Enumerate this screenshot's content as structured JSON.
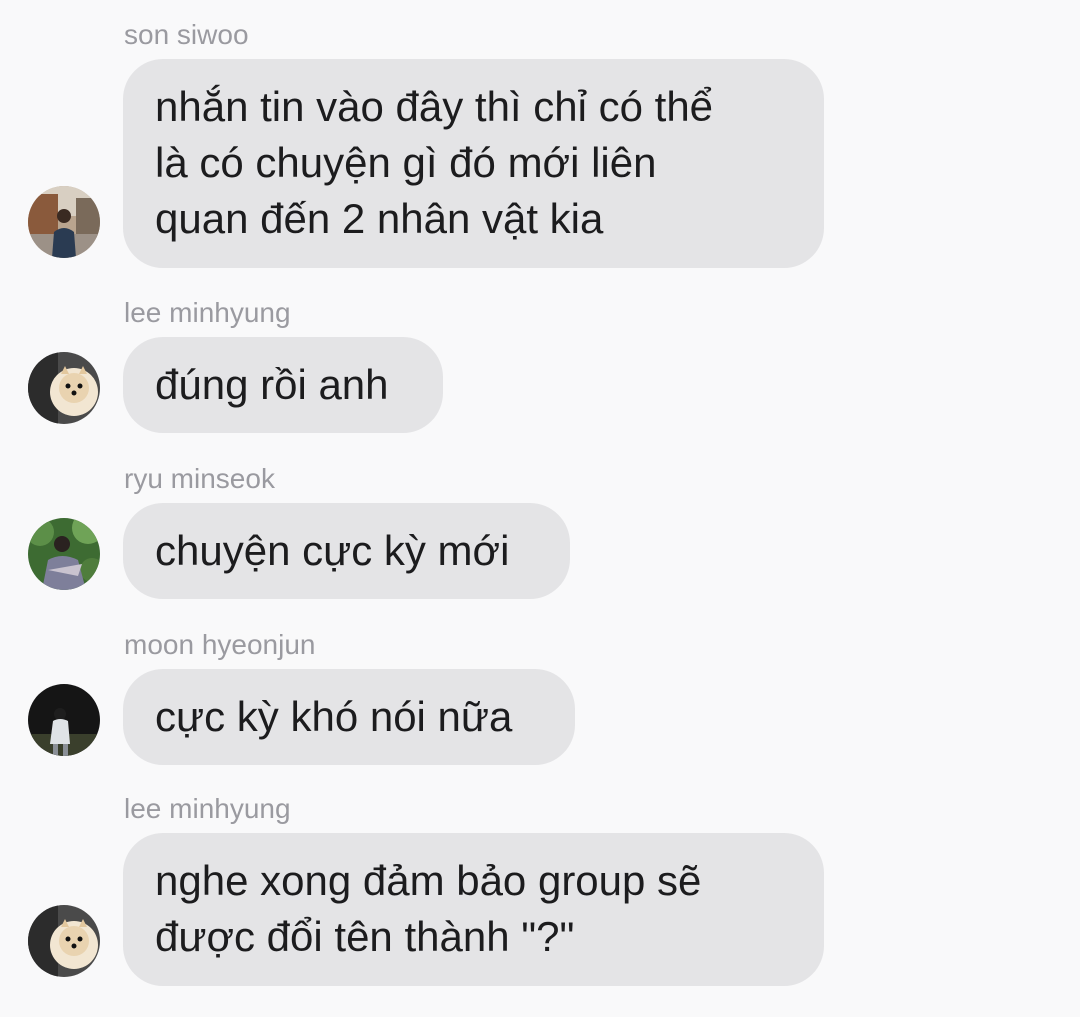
{
  "messages": [
    {
      "sender": "son siwoo",
      "text": "nhắn tin vào đây thì chỉ có thể\nlà có chuyện gì đó mới liên\nquan đến 2 nhân vật kia",
      "avatar": "person-in-street-photo-avatar"
    },
    {
      "sender": "lee minhyung",
      "text": "đúng rồi anh",
      "avatar": "pomeranian-dog-photo-avatar"
    },
    {
      "sender": "ryu minseok",
      "text": "chuyện cực kỳ mới",
      "avatar": "person-in-garden-photo-avatar"
    },
    {
      "sender": "moon hyeonjun",
      "text": "cực kỳ khó nói nữa",
      "avatar": "person-dark-background-photo-avatar"
    },
    {
      "sender": "lee minhyung",
      "text": "nghe xong đảm bảo group sẽ\nđược đổi tên thành \"?\"",
      "avatar": "pomeranian-dog-photo-avatar"
    }
  ],
  "colors": {
    "background": "#f9f9fa",
    "bubble": "#e4e4e6",
    "sender_name": "#9a9aa0",
    "message_text": "#1c1c1e"
  }
}
